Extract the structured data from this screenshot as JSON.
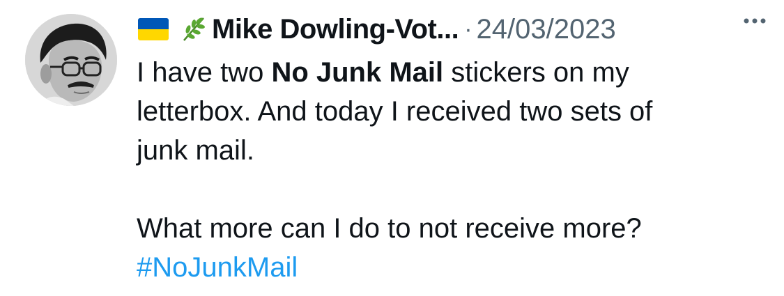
{
  "tweet": {
    "author": {
      "display_name": "Mike Dowling-Vot...",
      "name_icons": [
        "ukraine-flag-icon",
        "herb-icon"
      ]
    },
    "separator": "·",
    "timestamp": "24/03/2023",
    "more_icon": "more-horizontal-icon",
    "text": {
      "line1_part1": "I have two ",
      "line1_bold": "No Junk Mail",
      "line1_part2": " stickers on my",
      "line2": "letterbox. And today I received two sets of",
      "line3": "junk mail.",
      "line4": "What more can I do to not receive more?",
      "hashtag": "#NoJunkMail"
    },
    "colors": {
      "text": "#0f1419",
      "secondary": "#536471",
      "link": "#1d9bf0",
      "flag_blue": "#0057b7",
      "flag_yellow": "#ffd700",
      "herb_green": "#4a8a2a"
    }
  }
}
